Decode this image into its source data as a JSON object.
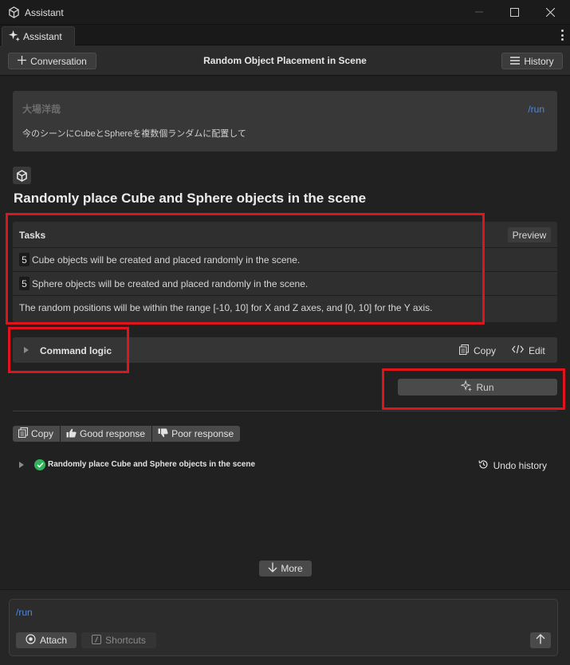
{
  "window": {
    "title": "Assistant"
  },
  "tabs": [
    {
      "label": "Assistant"
    }
  ],
  "toolbar": {
    "conversation_label": "Conversation",
    "page_title": "Random Object Placement in Scene",
    "history_label": "History"
  },
  "message": {
    "author": "大場洋哉",
    "command": "/run",
    "text": "今のシーンにCubeとSphereを複数個ランダムに配置して"
  },
  "response": {
    "heading": "Randomly place Cube and Sphere objects in the scene",
    "tasks": {
      "title": "Tasks",
      "preview_label": "Preview",
      "rows": [
        {
          "number": "5",
          "text": "Cube objects will be created and placed randomly in the scene."
        },
        {
          "number": "5",
          "text": "Sphere objects will be created and placed randomly in the scene."
        },
        {
          "number": "",
          "text": "The random positions will be within the range [-10, 10] for X and Z axes, and [0, 10] for the Y axis."
        }
      ]
    },
    "command_logic": {
      "label": "Command logic",
      "copy_label": "Copy",
      "edit_label": "Edit"
    },
    "run_label": "Run"
  },
  "feedback": {
    "copy_label": "Copy",
    "good_label": "Good response",
    "poor_label": "Poor response"
  },
  "result": {
    "text": "Randomly place Cube and Sphere objects in the scene",
    "undo_label": "Undo history",
    "status_color": "#2fb35a"
  },
  "more_label": "More",
  "input": {
    "value": "/run",
    "attach_label": "Attach",
    "shortcuts_label": "Shortcuts"
  },
  "colors": {
    "accent_link": "#4c87e0",
    "annotation_red": "#e0141c"
  }
}
